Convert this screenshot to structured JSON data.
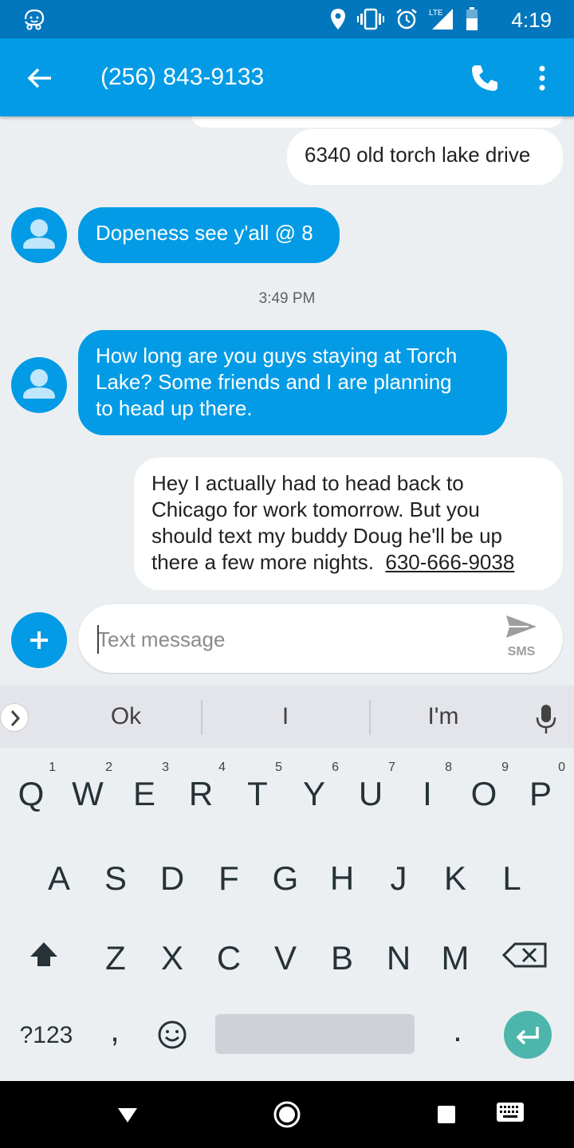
{
  "status_bar": {
    "time": "4:19",
    "icons": [
      "waze-icon",
      "location-icon",
      "vibrate-icon",
      "alarm-icon",
      "lte-signal-icon",
      "battery-icon"
    ],
    "lte_label": "LTE"
  },
  "app_bar": {
    "title": "(256) 843-9133",
    "color": "#039be5",
    "icons": [
      "back-arrow-icon",
      "phone-call-icon",
      "more-vertical-icon"
    ]
  },
  "messages": [
    {
      "direction": "outgoing",
      "text": "6340 old torch lake drive"
    },
    {
      "direction": "incoming",
      "text": "Dopeness see y'all @ 8"
    },
    {
      "type": "timestamp",
      "text": "3:49 PM"
    },
    {
      "direction": "incoming",
      "lines": [
        "How long are you guys staying at Torch",
        "Lake? Some friends and I are planning",
        "to head up there."
      ]
    },
    {
      "direction": "outgoing",
      "lines": [
        "Hey I actually had to head back to",
        "Chicago for work tomorrow. But you",
        "should text my buddy Doug he'll be up",
        "there a few more nights."
      ],
      "link": "630-666-9038"
    }
  ],
  "compose": {
    "placeholder": "Text message",
    "send_label": "SMS"
  },
  "keyboard": {
    "suggestions": [
      "Ok",
      "I",
      "I'm"
    ],
    "row1": [
      {
        "k": "Q",
        "n": "1"
      },
      {
        "k": "W",
        "n": "2"
      },
      {
        "k": "E",
        "n": "3"
      },
      {
        "k": "R",
        "n": "4"
      },
      {
        "k": "T",
        "n": "5"
      },
      {
        "k": "Y",
        "n": "6"
      },
      {
        "k": "U",
        "n": "7"
      },
      {
        "k": "I",
        "n": "8"
      },
      {
        "k": "O",
        "n": "9"
      },
      {
        "k": "P",
        "n": "0"
      }
    ],
    "row2": [
      "A",
      "S",
      "D",
      "F",
      "G",
      "H",
      "J",
      "K",
      "L"
    ],
    "row3": [
      "Z",
      "X",
      "C",
      "V",
      "B",
      "N",
      "M"
    ],
    "symbols_label": "?123",
    "comma": ",",
    "period": ".",
    "enter_color": "#4db6ac"
  },
  "nav_bar": {
    "icons": [
      "back-triangle-icon",
      "home-circle-icon",
      "recents-square-icon",
      "keyboard-switch-icon"
    ]
  }
}
